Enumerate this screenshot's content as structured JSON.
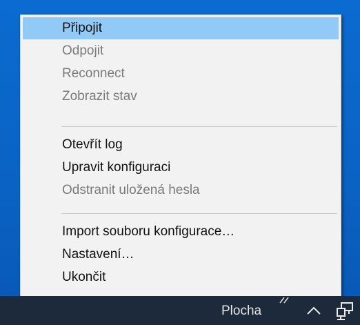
{
  "menu": {
    "items": [
      {
        "label": "Připojit",
        "enabled": true,
        "highlighted": true
      },
      {
        "label": "Odpojit",
        "enabled": false
      },
      {
        "label": "Reconnect",
        "enabled": false
      },
      {
        "label": "Zobrazit stav",
        "enabled": false
      },
      {
        "label": "Otevřít log",
        "enabled": true
      },
      {
        "label": "Upravit konfiguraci",
        "enabled": true
      },
      {
        "label": "Odstranit uložená hesla",
        "enabled": false
      },
      {
        "label": "Import souboru konfigurace…",
        "enabled": true
      },
      {
        "label": "Nastavení…",
        "enabled": true
      },
      {
        "label": "Ukončit",
        "enabled": true
      }
    ]
  },
  "taskbar": {
    "desktop_label": "Plocha",
    "icons": [
      "show-hidden-icons-chevron",
      "network-icon"
    ]
  },
  "colors": {
    "highlight": "#91c9f7",
    "menu_background": "#f2f2f2",
    "disabled_text": "#7a7a7a",
    "taskbar": "#1c2a3c",
    "desktop": "#0a6fd1"
  }
}
